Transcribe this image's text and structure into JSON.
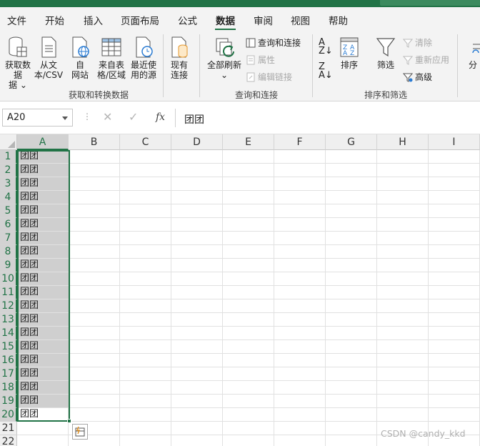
{
  "menu": {
    "tabs": [
      "文件",
      "开始",
      "插入",
      "页面布局",
      "公式",
      "数据",
      "审阅",
      "视图",
      "帮助"
    ],
    "active_tab": "数据"
  },
  "ribbon": {
    "get_transform": {
      "get_data": "获取数据",
      "get_data_2": "据",
      "from_text_csv_1": "从文",
      "from_text_csv_2": "本/CSV",
      "from_web_1": "自",
      "from_web_2": "网站",
      "from_table_1": "来自表",
      "from_table_2": "格/区域",
      "recent_sources_1": "最近使",
      "recent_sources_2": "用的源",
      "existing_conn_1": "现有",
      "existing_conn_2": "连接",
      "group_label": "获取和转换数据"
    },
    "queries": {
      "refresh_all": "全部刷新",
      "queries_connections": "查询和连接",
      "properties": "属性",
      "edit_links": "编辑链接",
      "group_label": "查询和连接"
    },
    "sort_filter": {
      "sort": "排序",
      "filter": "筛选",
      "clear": "清除",
      "reapply": "重新应用",
      "advanced": "高级",
      "group_label": "排序和筛选"
    },
    "split_partial": "分"
  },
  "formula_bar": {
    "name_box": "A20",
    "fx_label": "fx",
    "content": "团团"
  },
  "grid": {
    "columns": [
      "A",
      "B",
      "C",
      "D",
      "E",
      "F",
      "G",
      "H",
      "I"
    ],
    "rows": [
      "1",
      "2",
      "3",
      "4",
      "5",
      "6",
      "7",
      "8",
      "9",
      "10",
      "11",
      "12",
      "13",
      "14",
      "15",
      "16",
      "17",
      "18",
      "19",
      "20",
      "21",
      "22"
    ],
    "cell_value": "团团",
    "filled_rows": 20
  },
  "watermark": "CSDN @candy_kkd",
  "colors": {
    "accent": "#217346",
    "selection": "#cfcfcf"
  }
}
